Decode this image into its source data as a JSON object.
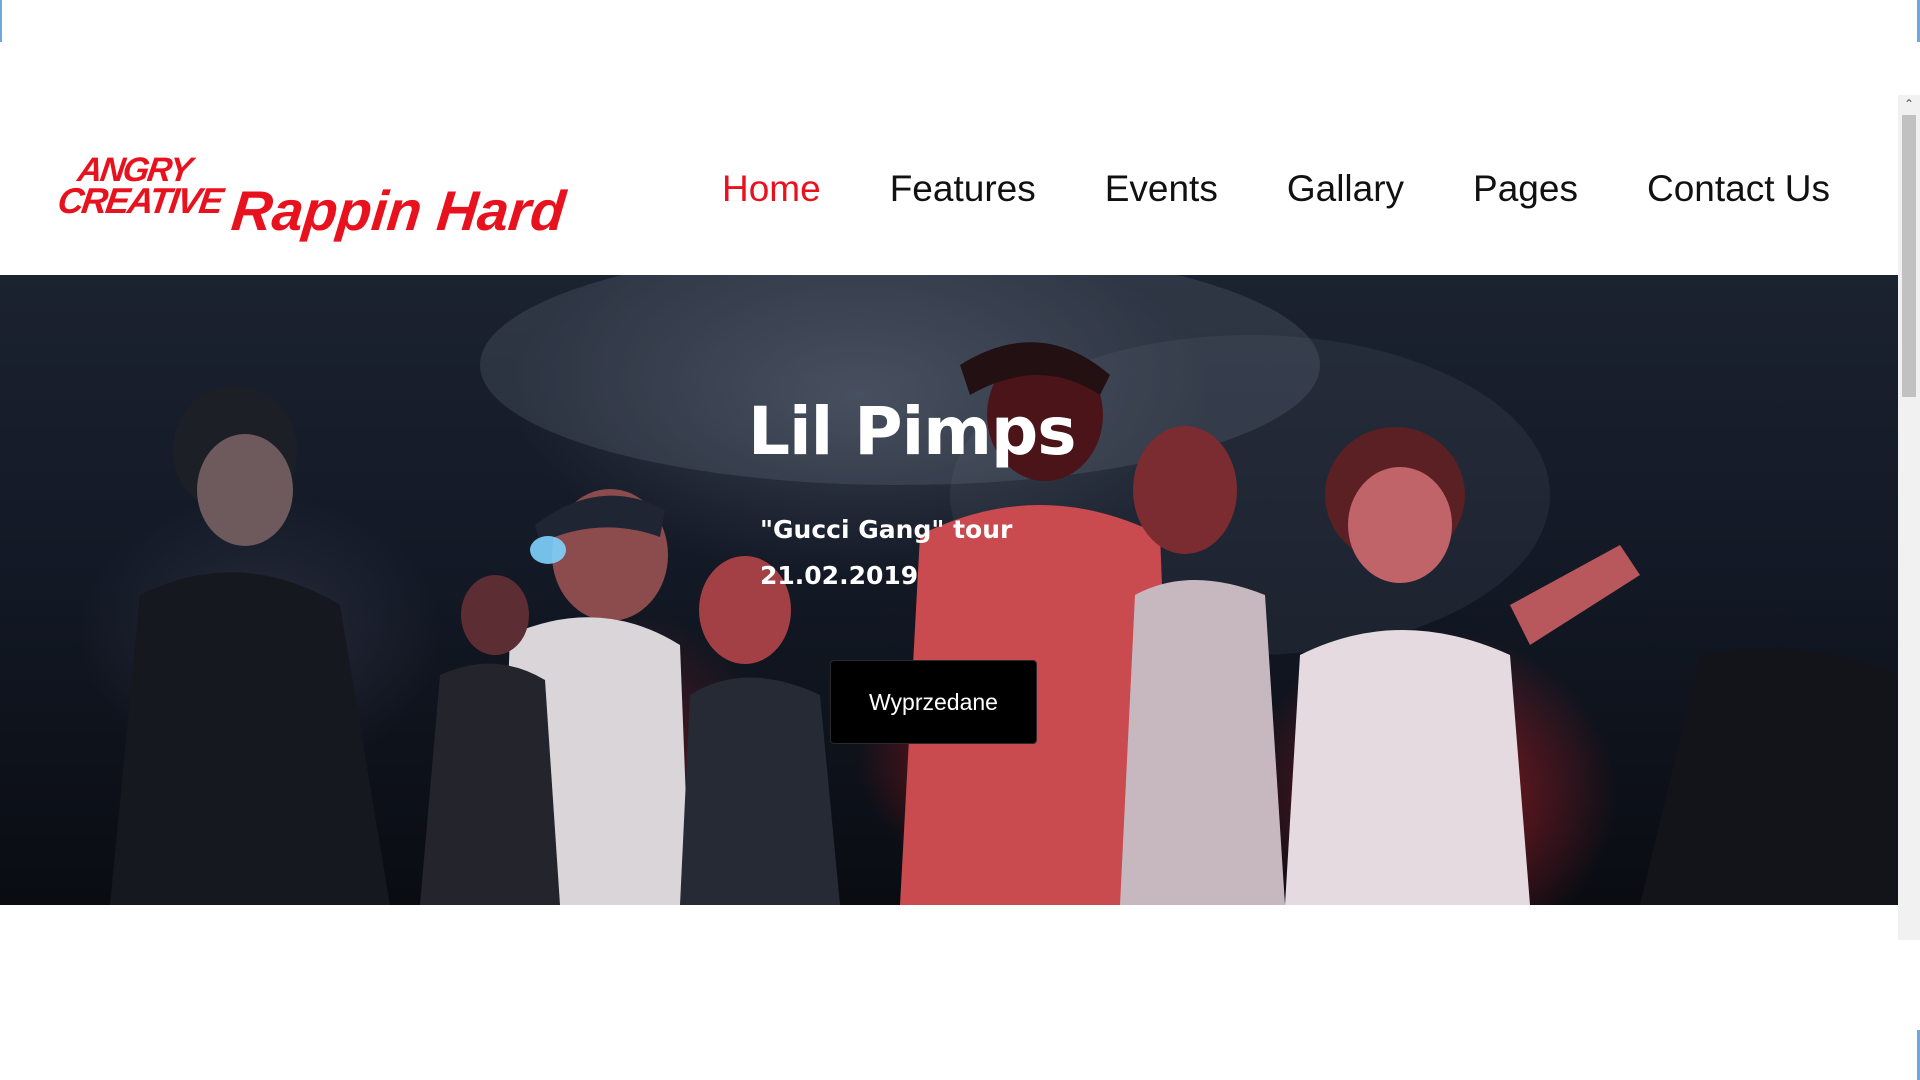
{
  "header": {
    "logo": {
      "line1": "ANGRY",
      "line2": "CREATIVE"
    },
    "brand": "Rappin Hard",
    "nav": [
      {
        "label": "Home",
        "active": true
      },
      {
        "label": "Features",
        "active": false
      },
      {
        "label": "Events",
        "active": false
      },
      {
        "label": "Gallary",
        "active": false
      },
      {
        "label": "Pages",
        "active": false
      },
      {
        "label": "Contact Us",
        "active": false
      }
    ]
  },
  "hero": {
    "title": "Lil Pimps",
    "subtitle": "\"Gucci Gang\" tour",
    "date": "21.02.2019",
    "button_label": "Wyprzedane",
    "background_image": "concert-crowd-photo"
  },
  "scrollbar": {
    "up_arrow_icon": "chevron-up-icon"
  },
  "colors": {
    "accent": "#e8121e",
    "nav_text": "#111111",
    "button_bg": "#000000",
    "button_text": "#ffffff",
    "page_bg": "#ffffff"
  }
}
